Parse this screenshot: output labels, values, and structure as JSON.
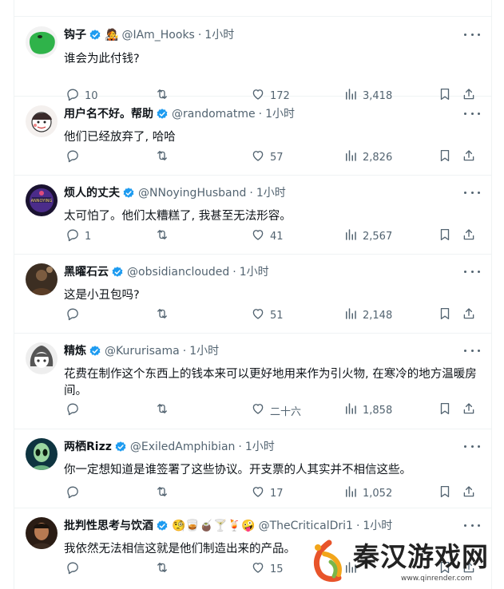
{
  "tweets": [
    {
      "name": "钩子",
      "handle": "@IAm_Hooks",
      "time": "1小时",
      "badge": "🧑‍🎤",
      "text": "谁会为此付钱?",
      "reply": "10",
      "retweet": "",
      "like": "172",
      "views": "3,418",
      "avatar": "green-blob"
    },
    {
      "name": "用户名不好。帮助",
      "handle": "@randomatme",
      "time": "1小时",
      "badge": "",
      "text": "他们已经放弃了, 哈哈",
      "reply": "",
      "retweet": "",
      "like": "57",
      "views": "2,826",
      "avatar": "sketch-face"
    },
    {
      "name": "烦人的丈夫",
      "handle": "@NNoyingHusband",
      "time": "1小时",
      "badge": "",
      "text": "太可怕了。他们太糟糕了, 我甚至无法形容。",
      "reply": "1",
      "retweet": "",
      "like": "41",
      "views": "2,567",
      "avatar": "badge-logo"
    },
    {
      "name": "黑曜石云",
      "handle": "@obsidianclouded",
      "time": "1小时",
      "badge": "",
      "text": "这是小丑包吗?",
      "reply": "",
      "retweet": "",
      "like": "51",
      "views": "2,148",
      "avatar": "dark-figure"
    },
    {
      "name": "精炼",
      "handle": "@Kururisama",
      "time": "1小时",
      "badge": "",
      "text": "花费在制作这个东西上的钱本来可以更好地用来作为引火物, 在寒冷的地方温暖房间。",
      "reply": "",
      "retweet": "",
      "like": "二十六",
      "views": "1,858",
      "avatar": "anime-girl"
    },
    {
      "name": "两栖Rizz",
      "handle": "@ExiledAmphibian",
      "time": "1小时",
      "badge": "",
      "text": "你一定想知道是谁签署了这些协议。开支票的人其实并不相信这些。",
      "reply": "",
      "retweet": "",
      "like": "17",
      "views": "1,052",
      "avatar": "alien"
    },
    {
      "name": "批判性思考与饮酒",
      "handle": "@TheCriticalDri1",
      "time": "1小时",
      "badge": "🧐🥃🧉🍸🍹🤪",
      "text": "我依然无法相信这就是他们制造出来的产品。",
      "reply": "",
      "retweet": "",
      "like": "15",
      "views": "",
      "avatar": "man-portrait"
    }
  ],
  "watermark": {
    "title": "秦汉游戏网",
    "url": "www.qinrender.com"
  },
  "colors": {
    "secondary": "#536471",
    "verified": "#1d9bf0",
    "border": "#eff3f4",
    "text": "#0f1419"
  }
}
